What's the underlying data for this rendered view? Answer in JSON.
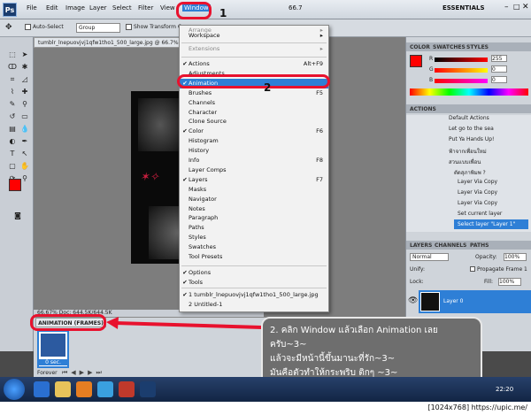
{
  "menubar": {
    "items": [
      "File",
      "Edit",
      "Image",
      "Layer",
      "Select",
      "Filter",
      "View",
      "Window"
    ],
    "zoom": "66.7",
    "workspace": "ESSENTIALS"
  },
  "options_bar": {
    "auto_select": "Auto-Select",
    "group_value": "Group",
    "show_transform": "Show Transform Co"
  },
  "document": {
    "tab": "tumblr_lnepuovjvj1qfw1tho1_500_large.jpg @ 66.7%",
    "status": "66.67%    Doc: 644.5K/644.5K"
  },
  "animation_panel": {
    "tab": "ANIMATION (FRAMES)",
    "frame_time": "0 sec.",
    "loop": "Forever"
  },
  "window_menu": {
    "header_items": [
      "Arrange",
      "Workspace"
    ],
    "extensions": "Extensions",
    "items": [
      {
        "label": "Actions",
        "shortcut": "Alt+F9",
        "checked": true
      },
      {
        "label": "Adjustments",
        "shortcut": "",
        "checked": false
      },
      {
        "label": "Animation",
        "shortcut": "",
        "checked": true,
        "selected": true
      },
      {
        "label": "Brushes",
        "shortcut": "F5",
        "checked": false
      },
      {
        "label": "Channels",
        "shortcut": "",
        "checked": false
      },
      {
        "label": "Character",
        "shortcut": "",
        "checked": false
      },
      {
        "label": "Clone Source",
        "shortcut": "",
        "checked": false
      },
      {
        "label": "Color",
        "shortcut": "F6",
        "checked": true
      },
      {
        "label": "Histogram",
        "shortcut": "",
        "checked": false
      },
      {
        "label": "History",
        "shortcut": "",
        "checked": false
      },
      {
        "label": "Info",
        "shortcut": "F8",
        "checked": false
      },
      {
        "label": "Layer Comps",
        "shortcut": "",
        "checked": false
      },
      {
        "label": "Layers",
        "shortcut": "F7",
        "checked": true
      },
      {
        "label": "Masks",
        "shortcut": "",
        "checked": false
      },
      {
        "label": "Navigator",
        "shortcut": "",
        "checked": false
      },
      {
        "label": "Notes",
        "shortcut": "",
        "checked": false
      },
      {
        "label": "Paragraph",
        "shortcut": "",
        "checked": false
      },
      {
        "label": "Paths",
        "shortcut": "",
        "checked": false
      },
      {
        "label": "Styles",
        "shortcut": "",
        "checked": false
      },
      {
        "label": "Swatches",
        "shortcut": "",
        "checked": false
      },
      {
        "label": "Tool Presets",
        "shortcut": "",
        "checked": false
      }
    ],
    "options": [
      {
        "label": "Options",
        "checked": true
      },
      {
        "label": "Tools",
        "checked": true
      }
    ],
    "documents": [
      {
        "label": "1 tumblr_lnepuovjvj1qfw1tho1_500_large.jpg",
        "checked": true
      },
      {
        "label": "2 Untitled-1",
        "checked": false
      }
    ]
  },
  "color_panel": {
    "tabs": [
      "COLOR",
      "SWATCHES",
      "STYLES"
    ],
    "r": "255",
    "g": "0",
    "b": "0"
  },
  "actions_panel": {
    "tab": "ACTIONS",
    "items": [
      "Default Actions",
      "Let go to the sea",
      "Put Ya Hands Up!",
      "ฟ้าจากเพื่อนใหม่",
      "สวนแบบเพื่อน",
      "ตัดสุภาพิมพ ?",
      "Layer Via Copy",
      "Layer Via Copy",
      "Layer Via Copy",
      "Set current layer",
      "Select layer \"Layer 1\""
    ]
  },
  "layers_panel": {
    "tabs": [
      "LAYERS",
      "CHANNELS",
      "PATHS"
    ],
    "blend": "Normal",
    "opacity_label": "Opacity:",
    "opacity": "100%",
    "unify": "Unify:",
    "propagate": "Propagate Frame 1",
    "lock": "Lock:",
    "fill_label": "Fill:",
    "fill": "100%",
    "layer": "Layer 0"
  },
  "annotations": {
    "num1": "1",
    "num2": "2",
    "note_lines": [
      "2. คลิก Window แล้วเลือก Animation เลยครับ~3~",
      "แล้วจะมีหน้านี้ขึ้นมานะที่รัก~3~",
      "มันคือตัวทำให้กระพริบ ติกๆ ~3~"
    ]
  },
  "taskbar": {
    "clock": "22:20"
  },
  "footer": "[1024x768] https://upic.me/",
  "colors": {
    "accent": "#2e7fd6",
    "annotation_red": "#e8122e",
    "foreground": "#ff0000"
  }
}
